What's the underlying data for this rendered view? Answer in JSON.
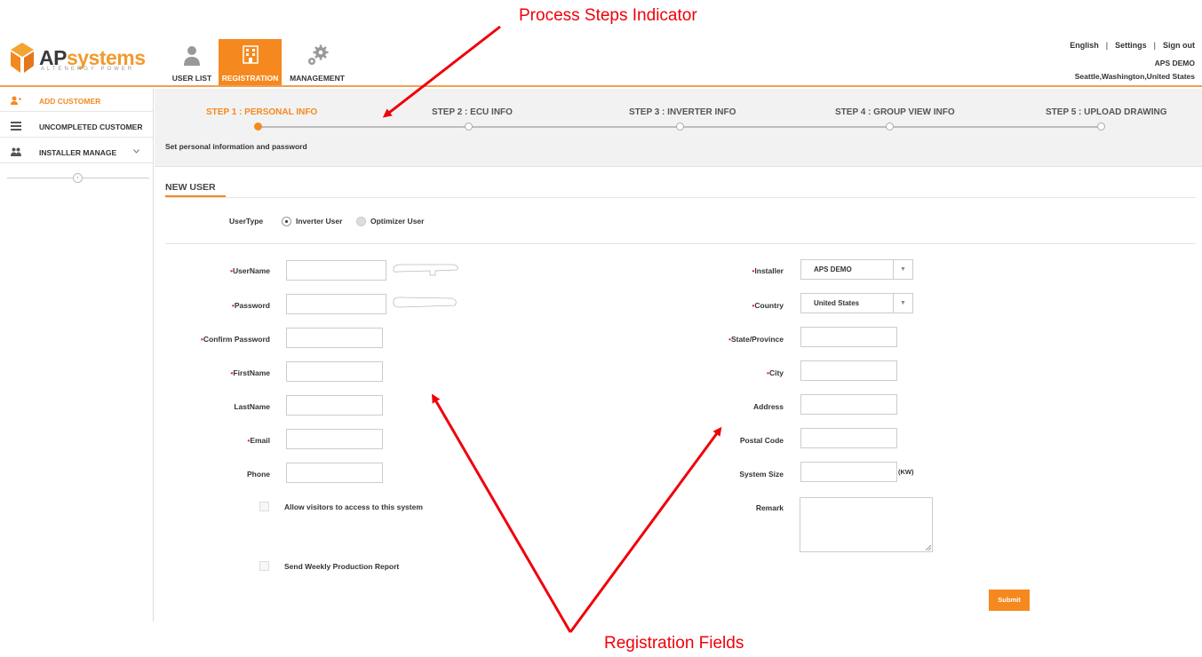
{
  "annotations": {
    "top": "Process Steps Indicator",
    "bottom": "Registration Fields"
  },
  "logo": {
    "brand_a": "AP",
    "brand_b": "systems",
    "tagline": "ALTENERGY POWER"
  },
  "nav": {
    "tabs": [
      {
        "label": "USER LIST",
        "icon": "user-list-icon"
      },
      {
        "label": "REGISTRATION",
        "icon": "building-icon"
      },
      {
        "label": "MANAGEMENT",
        "icon": "gears-icon"
      }
    ]
  },
  "top_links": {
    "language": "English",
    "separator": "|",
    "settings": "Settings",
    "signout": "Sign out",
    "user_name": "APS DEMO",
    "user_location": "Seattle,Washington,United States"
  },
  "sidebar": {
    "items": [
      {
        "label": "ADD CUSTOMER",
        "icon": "add-user-icon"
      },
      {
        "label": "UNCOMPLETED CUSTOMER",
        "icon": "list-icon"
      },
      {
        "label": "INSTALLER MANAGE",
        "icon": "users-icon"
      }
    ],
    "collapse_icon": "chevron-left-icon"
  },
  "steps": {
    "items": [
      "STEP 1 : PERSONAL INFO",
      "STEP 2 : ECU INFO",
      "STEP 3 : INVERTER INFO",
      "STEP 4 : GROUP VIEW INFO",
      "STEP 5 : UPLOAD DRAWING"
    ],
    "active_index": 0,
    "description": "Set personal information and password"
  },
  "form": {
    "section_title": "NEW USER",
    "user_type_label": "UserType",
    "user_type_options": [
      "Inverter User",
      "Optimizer User"
    ],
    "left_fields": {
      "username": "UserName",
      "password": "Password",
      "confirm_password": "Confirm Password",
      "firstname": "FirstName",
      "lastname": "LastName",
      "email": "Email",
      "phone": "Phone"
    },
    "right_fields": {
      "installer": "Installer",
      "installer_value": "APS DEMO",
      "country": "Country",
      "country_value": "United States",
      "state": "State/Province",
      "city": "City",
      "address": "Address",
      "postal": "Postal Code",
      "system_size": "System Size",
      "system_size_unit": "(KW)",
      "remark": "Remark"
    },
    "checkboxes": {
      "allow_visitors": "Allow visitors to access to this system",
      "weekly_report": "Send Weekly Production Report"
    },
    "required_mark": "•",
    "submit_label": "Submit"
  },
  "colors": {
    "accent": "#f5891f",
    "annotation": "#f0000a",
    "required": "#e23"
  }
}
